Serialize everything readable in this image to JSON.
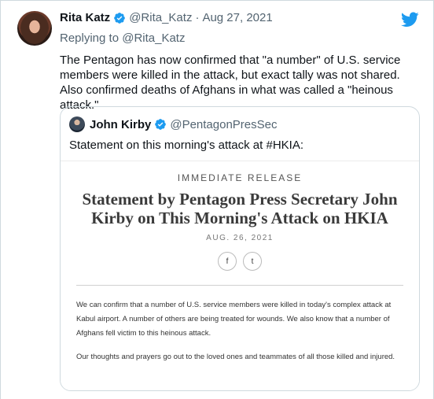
{
  "tweet": {
    "author_name": "Rita Katz",
    "handle": "@Rita_Katz",
    "separator": "·",
    "date": "Aug 27, 2021",
    "replying_prefix": "Replying to ",
    "replying_to": "@Rita_Katz",
    "text": "The Pentagon has now confirmed that \"a number\" of U.S. service members were killed in the attack, but exact tally was not shared. Also confirmed deaths of Afghans in what was called a \"heinous attack.\""
  },
  "quote": {
    "author_name": "John Kirby",
    "handle": "@PentagonPresSec",
    "text": "Statement on this morning's attack at #HKIA:",
    "release": {
      "kicker": "IMMEDIATE RELEASE",
      "title": "Statement by Pentagon Press Secretary John Kirby on This Morning's Attack on HKIA",
      "date": "AUG. 26, 2021",
      "share_facebook": "f",
      "share_twitter": "t",
      "paragraph1": "We can confirm that a number of U.S. service members were killed in today's complex attack at Kabul airport.  A number of others are being treated for wounds. We also know that a number of Afghans fell victim to this heinous attack.",
      "paragraph2": "Our thoughts and prayers go out to the loved ones and teammates of all those killed and injured."
    }
  },
  "colors": {
    "verified": "#1d9bf0",
    "twitter_brand": "#1d9bf0",
    "secondary_text": "#536471",
    "border": "#cfd9de"
  },
  "icons": {
    "verified": "verified-badge-icon",
    "brand": "twitter-bird-icon"
  }
}
